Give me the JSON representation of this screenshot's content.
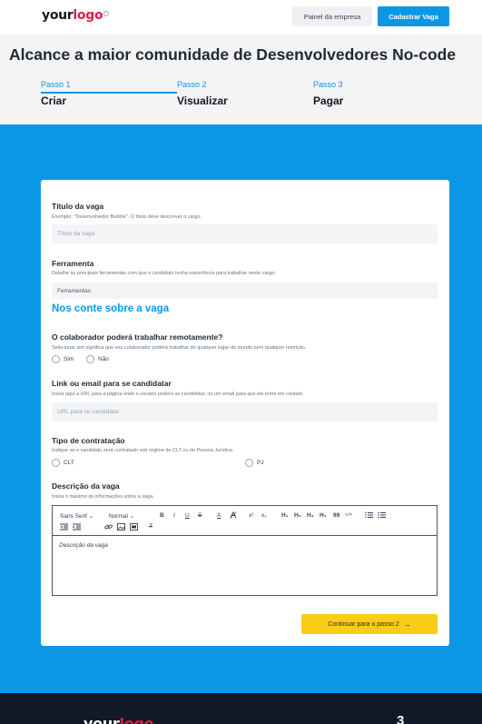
{
  "header": {
    "logo_your": "your",
    "logo_logo": "logo",
    "panel_button": "Painel da empresa",
    "post_button": "Cadastrar Vaga"
  },
  "page_title": "Alcance a maior comunidade de Desenvolvedores No-code",
  "steps": [
    {
      "number": "Passo 1",
      "name": "Criar",
      "active": true
    },
    {
      "number": "Passo 2",
      "name": "Visualizar",
      "active": false
    },
    {
      "number": "Passo 3",
      "name": "Pagar",
      "active": false
    }
  ],
  "form": {
    "job_title": {
      "label": "Título da vaga",
      "help": "Exemplo: \"Desenvolvedor Bubble\". O título deve descrever o cargo.",
      "placeholder": "Título da vaga"
    },
    "tool": {
      "label": "Ferramenta",
      "help": "Detalhe as principais ferramentas com que o candidato tenha experiência para trabalhar neste cargo.",
      "value": "Ferramentas"
    },
    "section_title": "Nos conte sobre a vaga",
    "remote": {
      "label": "O colaborador poderá trabalhar remotamente?",
      "help": "Selecionar sim significa que seu colaborador poderá trabalhar de qualquer lugar do mundo sem qualquer restrição.",
      "options": [
        "Sim",
        "Não"
      ]
    },
    "apply_link": {
      "label": "Link ou email para se candidatar",
      "help": "Insira aqui a URL para a página onde o usuário poderá se candidatar, ou um email para que ele entre em contato.",
      "placeholder": "URL para se candidatar"
    },
    "contract": {
      "label": "Tipo de contratação",
      "help": "Indique se o candidato será contratado sob regime de CLT ou de Pessoa Jurídica.",
      "options": [
        "CLT",
        "PJ"
      ]
    },
    "description": {
      "label": "Descrição da vaga",
      "help": "Insira o máximo de informações sobre a vaga.",
      "font_select": "Sans Serif",
      "size_select": "Normal",
      "placeholder": "Descrição da vaga"
    },
    "next_button": "Continuar para o passo 2"
  },
  "toolbar_glyphs": {
    "bold": "B",
    "italic": "I",
    "underline": "U",
    "strike": "S",
    "color": "A",
    "superscript": "x²",
    "subscript": "x₂",
    "h1": "H₁",
    "h2": "H₂",
    "h3": "H₃",
    "h4": "H₄",
    "blockquote": "99",
    "code": "</>",
    "clean": "T"
  },
  "footer": {
    "logo_your": "your",
    "logo_logo": "logo",
    "number": "3"
  },
  "colors": {
    "accent": "#0b97e6",
    "cta": "#facc15",
    "logo": "#e11d48",
    "footer": "#111827"
  },
  "icons": {
    "next": "arrow-right-icon",
    "chevron": "chevron-down-icon"
  }
}
